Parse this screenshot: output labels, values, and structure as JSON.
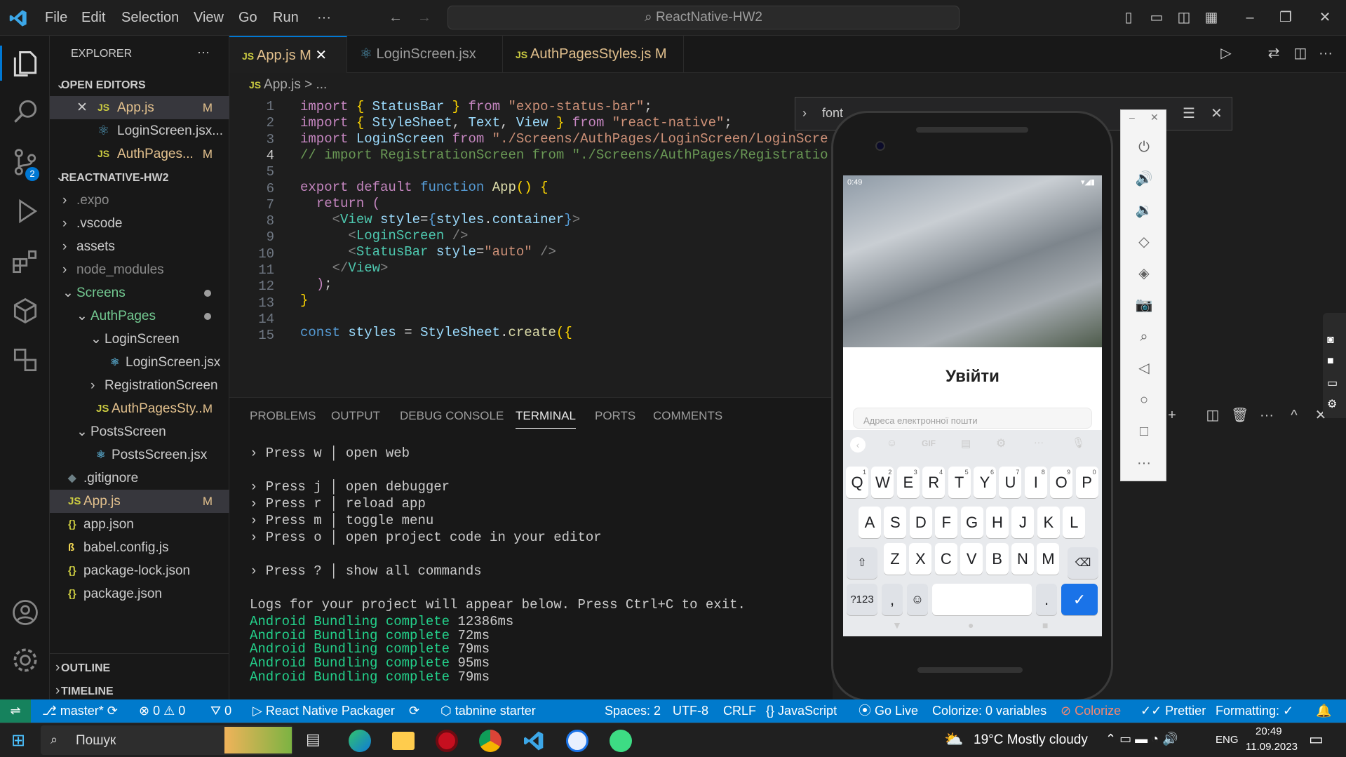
{
  "titlebar": {
    "menus": [
      "File",
      "Edit",
      "Selection",
      "View",
      "Go",
      "Run",
      "···"
    ],
    "search": "ReactNative-HW2"
  },
  "sidebar": {
    "title": "EXPLORER",
    "more": "···",
    "open_editors_header": "OPEN EDITORS",
    "open_editors": [
      {
        "name": "App.js",
        "badge": "M",
        "type": "js",
        "close": "✕"
      },
      {
        "name": "LoginScreen.jsx...",
        "badge": "",
        "type": "jsx"
      },
      {
        "name": "AuthPages...",
        "badge": "M",
        "type": "js"
      }
    ],
    "project_header": "REACTNATIVE-HW2",
    "tree": [
      {
        "name": ".expo",
        "chev": "›",
        "indent": 0,
        "dim": true
      },
      {
        "name": ".vscode",
        "chev": "›",
        "indent": 0
      },
      {
        "name": "assets",
        "chev": "›",
        "indent": 0
      },
      {
        "name": "node_modules",
        "chev": "›",
        "indent": 0,
        "dim": true
      },
      {
        "name": "Screens",
        "chev": "⌄",
        "indent": 0,
        "dot": true,
        "color": "#73c991"
      },
      {
        "name": "AuthPages",
        "chev": "⌄",
        "indent": 1,
        "dot": true,
        "color": "#73c991"
      },
      {
        "name": "LoginScreen",
        "chev": "⌄",
        "indent": 2
      },
      {
        "name": "LoginScreen.jsx",
        "chev": "",
        "indent": 3,
        "icon": "jsx"
      },
      {
        "name": "RegistrationScreen",
        "chev": "›",
        "indent": 2
      },
      {
        "name": "AuthPagesSty...",
        "chev": "",
        "indent": 2,
        "icon": "js",
        "badge": "M",
        "color": "#e2c08d"
      },
      {
        "name": "PostsScreen",
        "chev": "⌄",
        "indent": 1
      },
      {
        "name": "PostsScreen.jsx",
        "chev": "",
        "indent": 2,
        "icon": "jsx"
      },
      {
        "name": ".gitignore",
        "chev": "",
        "indent": 0,
        "icon": "git"
      },
      {
        "name": "App.js",
        "chev": "",
        "indent": 0,
        "icon": "js",
        "badge": "M",
        "color": "#e2c08d",
        "selected": true
      },
      {
        "name": "app.json",
        "chev": "",
        "indent": 0,
        "icon": "json"
      },
      {
        "name": "babel.config.js",
        "chev": "",
        "indent": 0,
        "icon": "babel"
      },
      {
        "name": "package-lock.json",
        "chev": "",
        "indent": 0,
        "icon": "json"
      },
      {
        "name": "package.json",
        "chev": "",
        "indent": 0,
        "icon": "json"
      }
    ],
    "outline": "OUTLINE",
    "timeline": "TIMELINE"
  },
  "tabs": [
    {
      "label": "App.js",
      "badge": "M",
      "icon": "JS",
      "active": true
    },
    {
      "label": "LoginScreen.jsx",
      "badge": "",
      "icon": "⚛"
    },
    {
      "label": "AuthPagesStyles.js",
      "badge": "M",
      "icon": "JS"
    }
  ],
  "breadcrumb": "App.js > ...",
  "code_lines": [
    "1",
    "2",
    "3",
    "4",
    "5",
    "6",
    "7",
    "8",
    "9",
    "10",
    "11",
    "12",
    "13",
    "14",
    "15"
  ],
  "find": {
    "value": "font"
  },
  "panel": {
    "tabs": [
      "PROBLEMS",
      "OUTPUT",
      "DEBUG CONSOLE",
      "TERMINAL",
      "PORTS",
      "COMMENTS"
    ],
    "lines": [
      "› Press w │ open web",
      "› Press j │ open debugger",
      "› Press r │ reload app",
      "› Press m │ toggle menu",
      "› Press o │ open project code in your editor",
      "› Press ? │ show all commands",
      "Logs for your project will appear below. Press Ctrl+C to exit."
    ],
    "bundles": [
      {
        "a": "Android",
        "b": "Bundling complete",
        "t": "12386ms"
      },
      {
        "a": "Android",
        "b": "Bundling complete",
        "t": "72ms"
      },
      {
        "a": "Android",
        "b": "Bundling complete",
        "t": "79ms"
      },
      {
        "a": "Android",
        "b": "Bundling complete",
        "t": "95ms"
      },
      {
        "a": "Android",
        "b": "Bundling complete",
        "t": "79ms"
      }
    ]
  },
  "phone": {
    "time": "0:49",
    "login_title": "Увійти",
    "email_placeholder": "Адреса електронної пошти",
    "kb_row1": [
      "Q",
      "W",
      "E",
      "R",
      "T",
      "Y",
      "U",
      "I",
      "O",
      "P"
    ],
    "kb_row1_nums": [
      "1",
      "2",
      "3",
      "4",
      "5",
      "6",
      "7",
      "8",
      "9",
      "0"
    ],
    "kb_row2": [
      "A",
      "S",
      "D",
      "F",
      "G",
      "H",
      "J",
      "K",
      "L"
    ],
    "kb_row3": [
      "Z",
      "X",
      "C",
      "V",
      "B",
      "N",
      "M"
    ],
    "kb_sym": "?123",
    "kb_comma": ",",
    "kb_dot": ".",
    "kb_gif": "GIF"
  },
  "statusbar": {
    "branch": "master*",
    "errors": "0",
    "warnings": "0",
    "ports": "0",
    "packager": "React Native Packager",
    "tabnine": "tabnine starter",
    "spaces": "Spaces: 2",
    "encoding": "UTF-8",
    "eol": "CRLF",
    "language": "JavaScript",
    "golive": "Go Live",
    "colorize_vars": "Colorize: 0 variables",
    "colorize": "Colorize",
    "prettier": "Prettier",
    "formatting": "Formatting: ✓"
  },
  "taskbar": {
    "search": "Пошук",
    "weather": "19°C  Mostly cloudy",
    "lang": "ENG",
    "time": "20:49",
    "date": "11.09.2023"
  }
}
